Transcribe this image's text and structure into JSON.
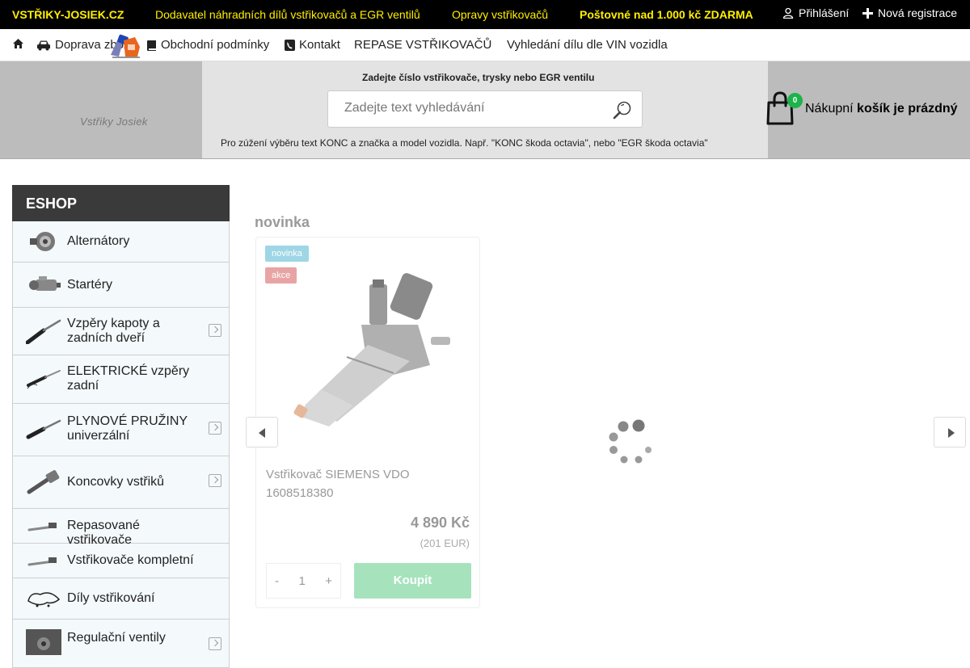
{
  "topbar": {
    "brand": "VSTŘIKY-JOSIEK.CZ",
    "tagline": "Dodavatel náhradních dílů vstřikovačů a EGR ventilů",
    "repairs": "Opravy vstřikovačů",
    "shipping": "Poštovné nad 1.000 kč ZDARMA",
    "login": "Přihlášení",
    "register": "Nová registrace"
  },
  "nav": {
    "items": [
      "Doprava zboží",
      "Obchodní podmínky",
      "Kontakt",
      "REPASE VSTŘIKOVAČŮ",
      "Vyhledání dílu dle VIN vozidla"
    ]
  },
  "header": {
    "logo_text": "Vstřiky Josiek",
    "search_title": "Zadejte číslo vstřikovače, trysky nebo EGR ventilu",
    "search_placeholder": "Zadejte text vyhledávání",
    "search_hint": "Pro zúžení výběru text KONC a značka a model vozidla. Např. \"KONC škoda octavia\", nebo \"EGR škoda octavia\"",
    "cart_count": "0",
    "cart_label": "Nákupní",
    "cart_state": "košík je prázdný"
  },
  "sidebar": {
    "title": "ESHOP",
    "categories": [
      {
        "label": "Alternátory"
      },
      {
        "label": "Startéry"
      },
      {
        "label": "Vzpěry kapoty a zadních dveří"
      },
      {
        "label": "ELEKTRICKÉ vzpěry zadní"
      },
      {
        "label": "PLYNOVÉ PRUŽINY univerzální"
      },
      {
        "label": "Koncovky vstřiků"
      },
      {
        "label": "Repasované vstřikovače"
      },
      {
        "label": "Vstřikovače kompletní"
      },
      {
        "label": "Díly vstřikování"
      },
      {
        "label": "Regulační ventily"
      }
    ]
  },
  "main": {
    "section_title": "novinka",
    "product": {
      "badge_new": "novinka",
      "badge_sale": "akce",
      "name": "Vstřikovač SIEMENS VDO 1608518380",
      "price": "4 890 Kč",
      "price_eur": "(201 EUR)",
      "qty_minus": "-",
      "qty_value": "1",
      "qty_plus": "+",
      "buy_label": "Koupit"
    }
  },
  "colors": {
    "topbar_bg": "#000000",
    "topbar_accent": "#ffef00",
    "header_band": "#bcbcbc",
    "cart_badge": "#1cb34a",
    "buy_button": "#a6e3bd"
  }
}
